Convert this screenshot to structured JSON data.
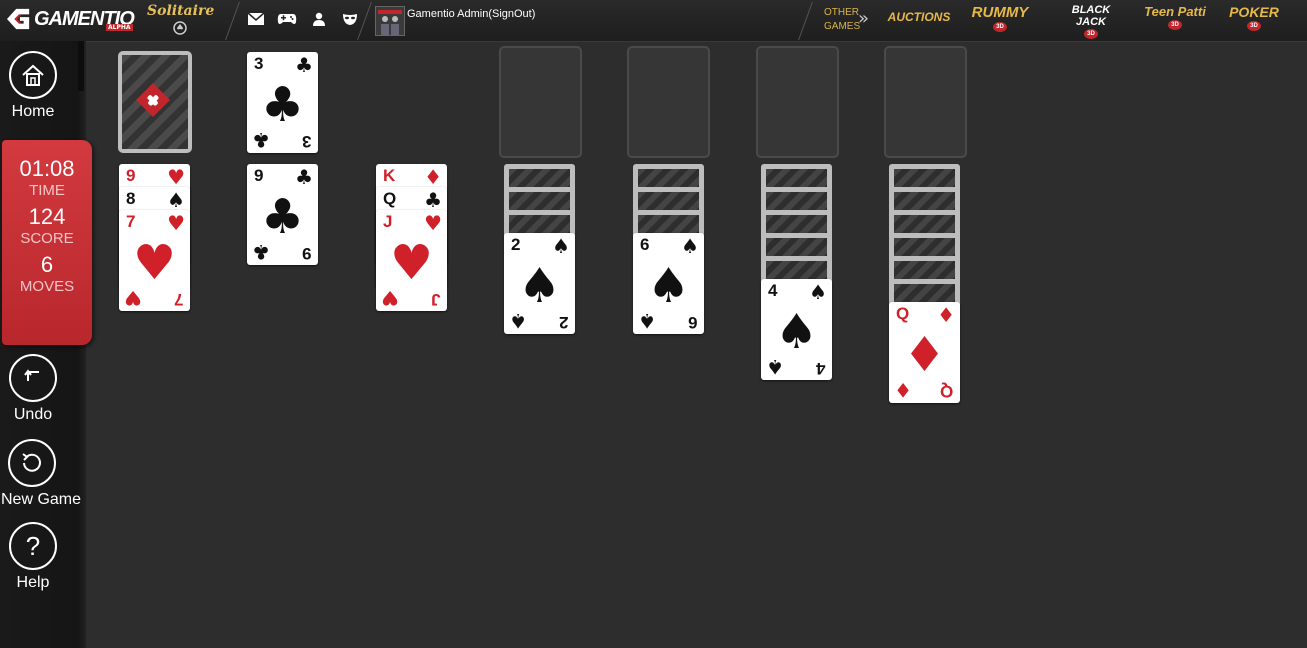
{
  "header": {
    "brand": "GAMENTIO",
    "brand_tag": "ALPHA",
    "game_logo": "Solitaire",
    "icons": [
      "mail-icon",
      "gamepad-icon",
      "user-icon",
      "mask-icon"
    ],
    "user_label": "Gamentio Admin(SignOut)",
    "other_games_line1": "OTHER",
    "other_games_line2": "GAMES",
    "games": [
      "AUCTIONS",
      "RUMMY",
      "BLACK JACK",
      "Teen Patti",
      "POKER"
    ],
    "game_badge": "3D"
  },
  "sidebar": {
    "home": "Home",
    "undo": "Undo",
    "new_game": "New Game",
    "help": "Help"
  },
  "stats": {
    "time": "01:08",
    "time_label": "TIME",
    "score": "124",
    "score_label": "SCORE",
    "moves": "6",
    "moves_label": "MOVES"
  },
  "board": {
    "waste": {
      "rank": "3",
      "suit": "♣",
      "color": "black"
    },
    "tableau": [
      {
        "hidden": 0,
        "cards": [
          {
            "rank": "9",
            "suit": "♥",
            "color": "red"
          },
          {
            "rank": "8",
            "suit": "♠",
            "color": "black"
          },
          {
            "rank": "7",
            "suit": "♥",
            "color": "red"
          }
        ]
      },
      {
        "hidden": 0,
        "cards": [
          {
            "rank": "9",
            "suit": "♣",
            "color": "black"
          }
        ]
      },
      {
        "hidden": 0,
        "cards": [
          {
            "rank": "K",
            "suit": "♦",
            "color": "red"
          },
          {
            "rank": "Q",
            "suit": "♣",
            "color": "black"
          },
          {
            "rank": "J",
            "suit": "♥",
            "color": "red"
          }
        ]
      },
      {
        "hidden": 3,
        "cards": [
          {
            "rank": "2",
            "suit": "♠",
            "color": "black"
          }
        ]
      },
      {
        "hidden": 3,
        "cards": [
          {
            "rank": "6",
            "suit": "♠",
            "color": "black"
          }
        ]
      },
      {
        "hidden": 5,
        "cards": [
          {
            "rank": "4",
            "suit": "♠",
            "color": "black"
          }
        ]
      },
      {
        "hidden": 6,
        "cards": [
          {
            "rank": "Q",
            "suit": "♦",
            "color": "red"
          }
        ]
      }
    ]
  },
  "colors": {
    "accent_red": "#c0262b",
    "gold": "#e6b84a",
    "background": "#2d2d2d"
  }
}
